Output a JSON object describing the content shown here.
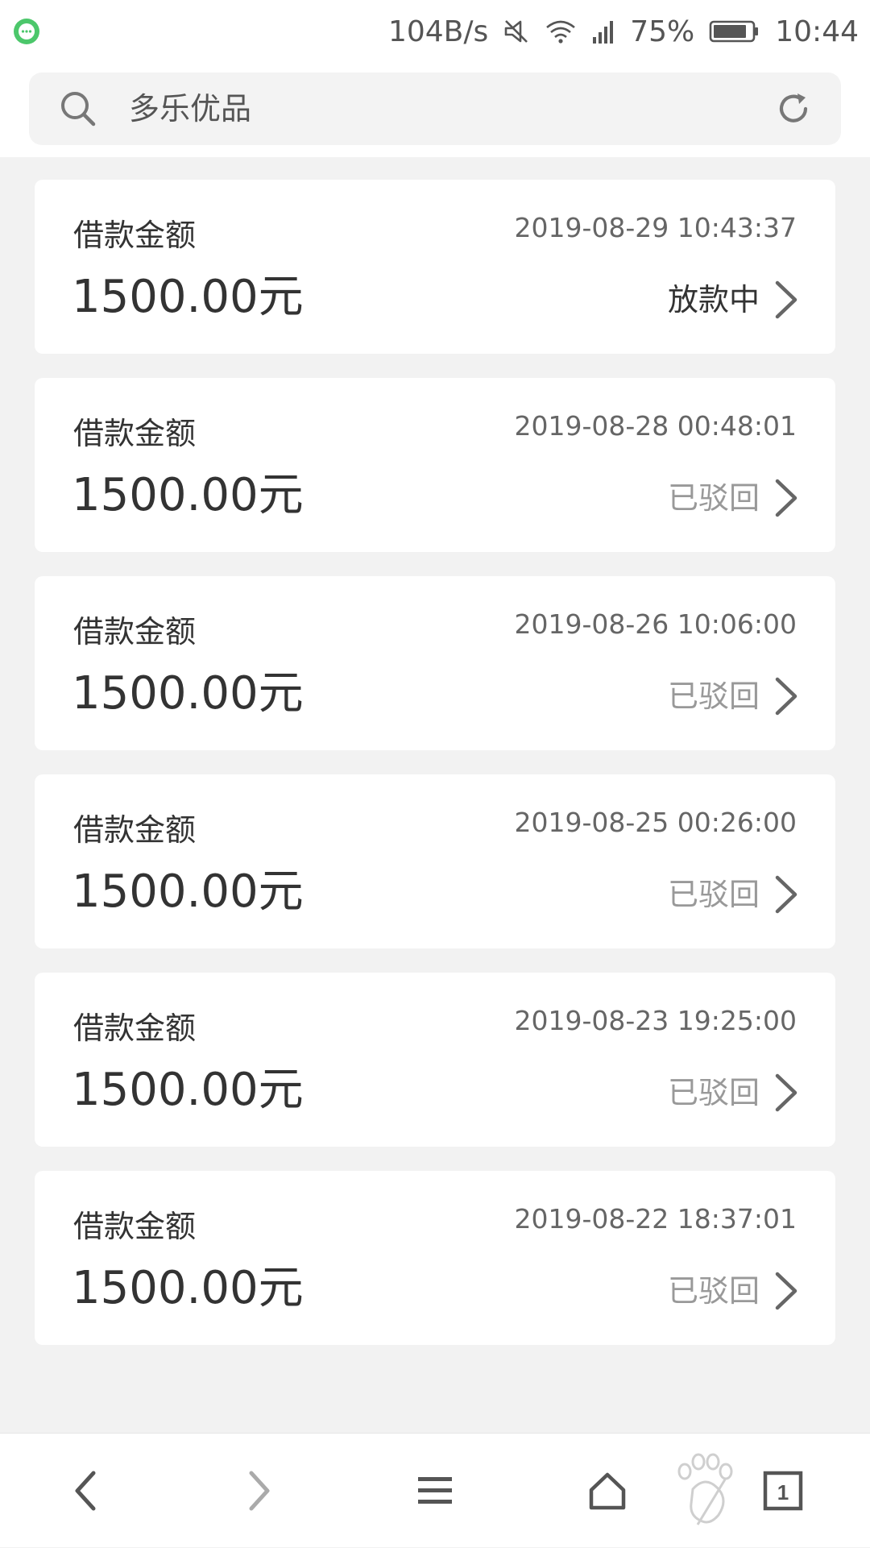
{
  "status_bar": {
    "network_speed": "104B/s",
    "battery_percent": "75%",
    "time": "10:44",
    "icons": [
      "chat-bubble-icon",
      "mute-icon",
      "wifi-icon",
      "signal-icon",
      "battery-icon"
    ]
  },
  "search": {
    "text": "多乐优品"
  },
  "loans": [
    {
      "label": "借款金额",
      "amount": "1500.00元",
      "time": "2019-08-29 10:43:37",
      "status": "放款中"
    },
    {
      "label": "借款金额",
      "amount": "1500.00元",
      "time": "2019-08-28 00:48:01",
      "status": "已驳回"
    },
    {
      "label": "借款金额",
      "amount": "1500.00元",
      "time": "2019-08-26 10:06:00",
      "status": "已驳回"
    },
    {
      "label": "借款金额",
      "amount": "1500.00元",
      "time": "2019-08-25 00:26:00",
      "status": "已驳回"
    },
    {
      "label": "借款金额",
      "amount": "1500.00元",
      "time": "2019-08-23 19:25:00",
      "status": "已驳回"
    },
    {
      "label": "借款金额",
      "amount": "1500.00元",
      "time": "2019-08-22 18:37:01",
      "status": "已驳回"
    }
  ],
  "bottom_nav": {
    "tab_count": "1",
    "icons": [
      "back-icon",
      "forward-icon",
      "menu-icon",
      "home-icon",
      "paw-icon",
      "tabs-icon"
    ]
  },
  "colors": {
    "page_bg": "#f2f2f2",
    "card_bg": "#ffffff",
    "text_primary": "#333333",
    "text_secondary": "#999999",
    "status_dot": "#4cc76b"
  }
}
